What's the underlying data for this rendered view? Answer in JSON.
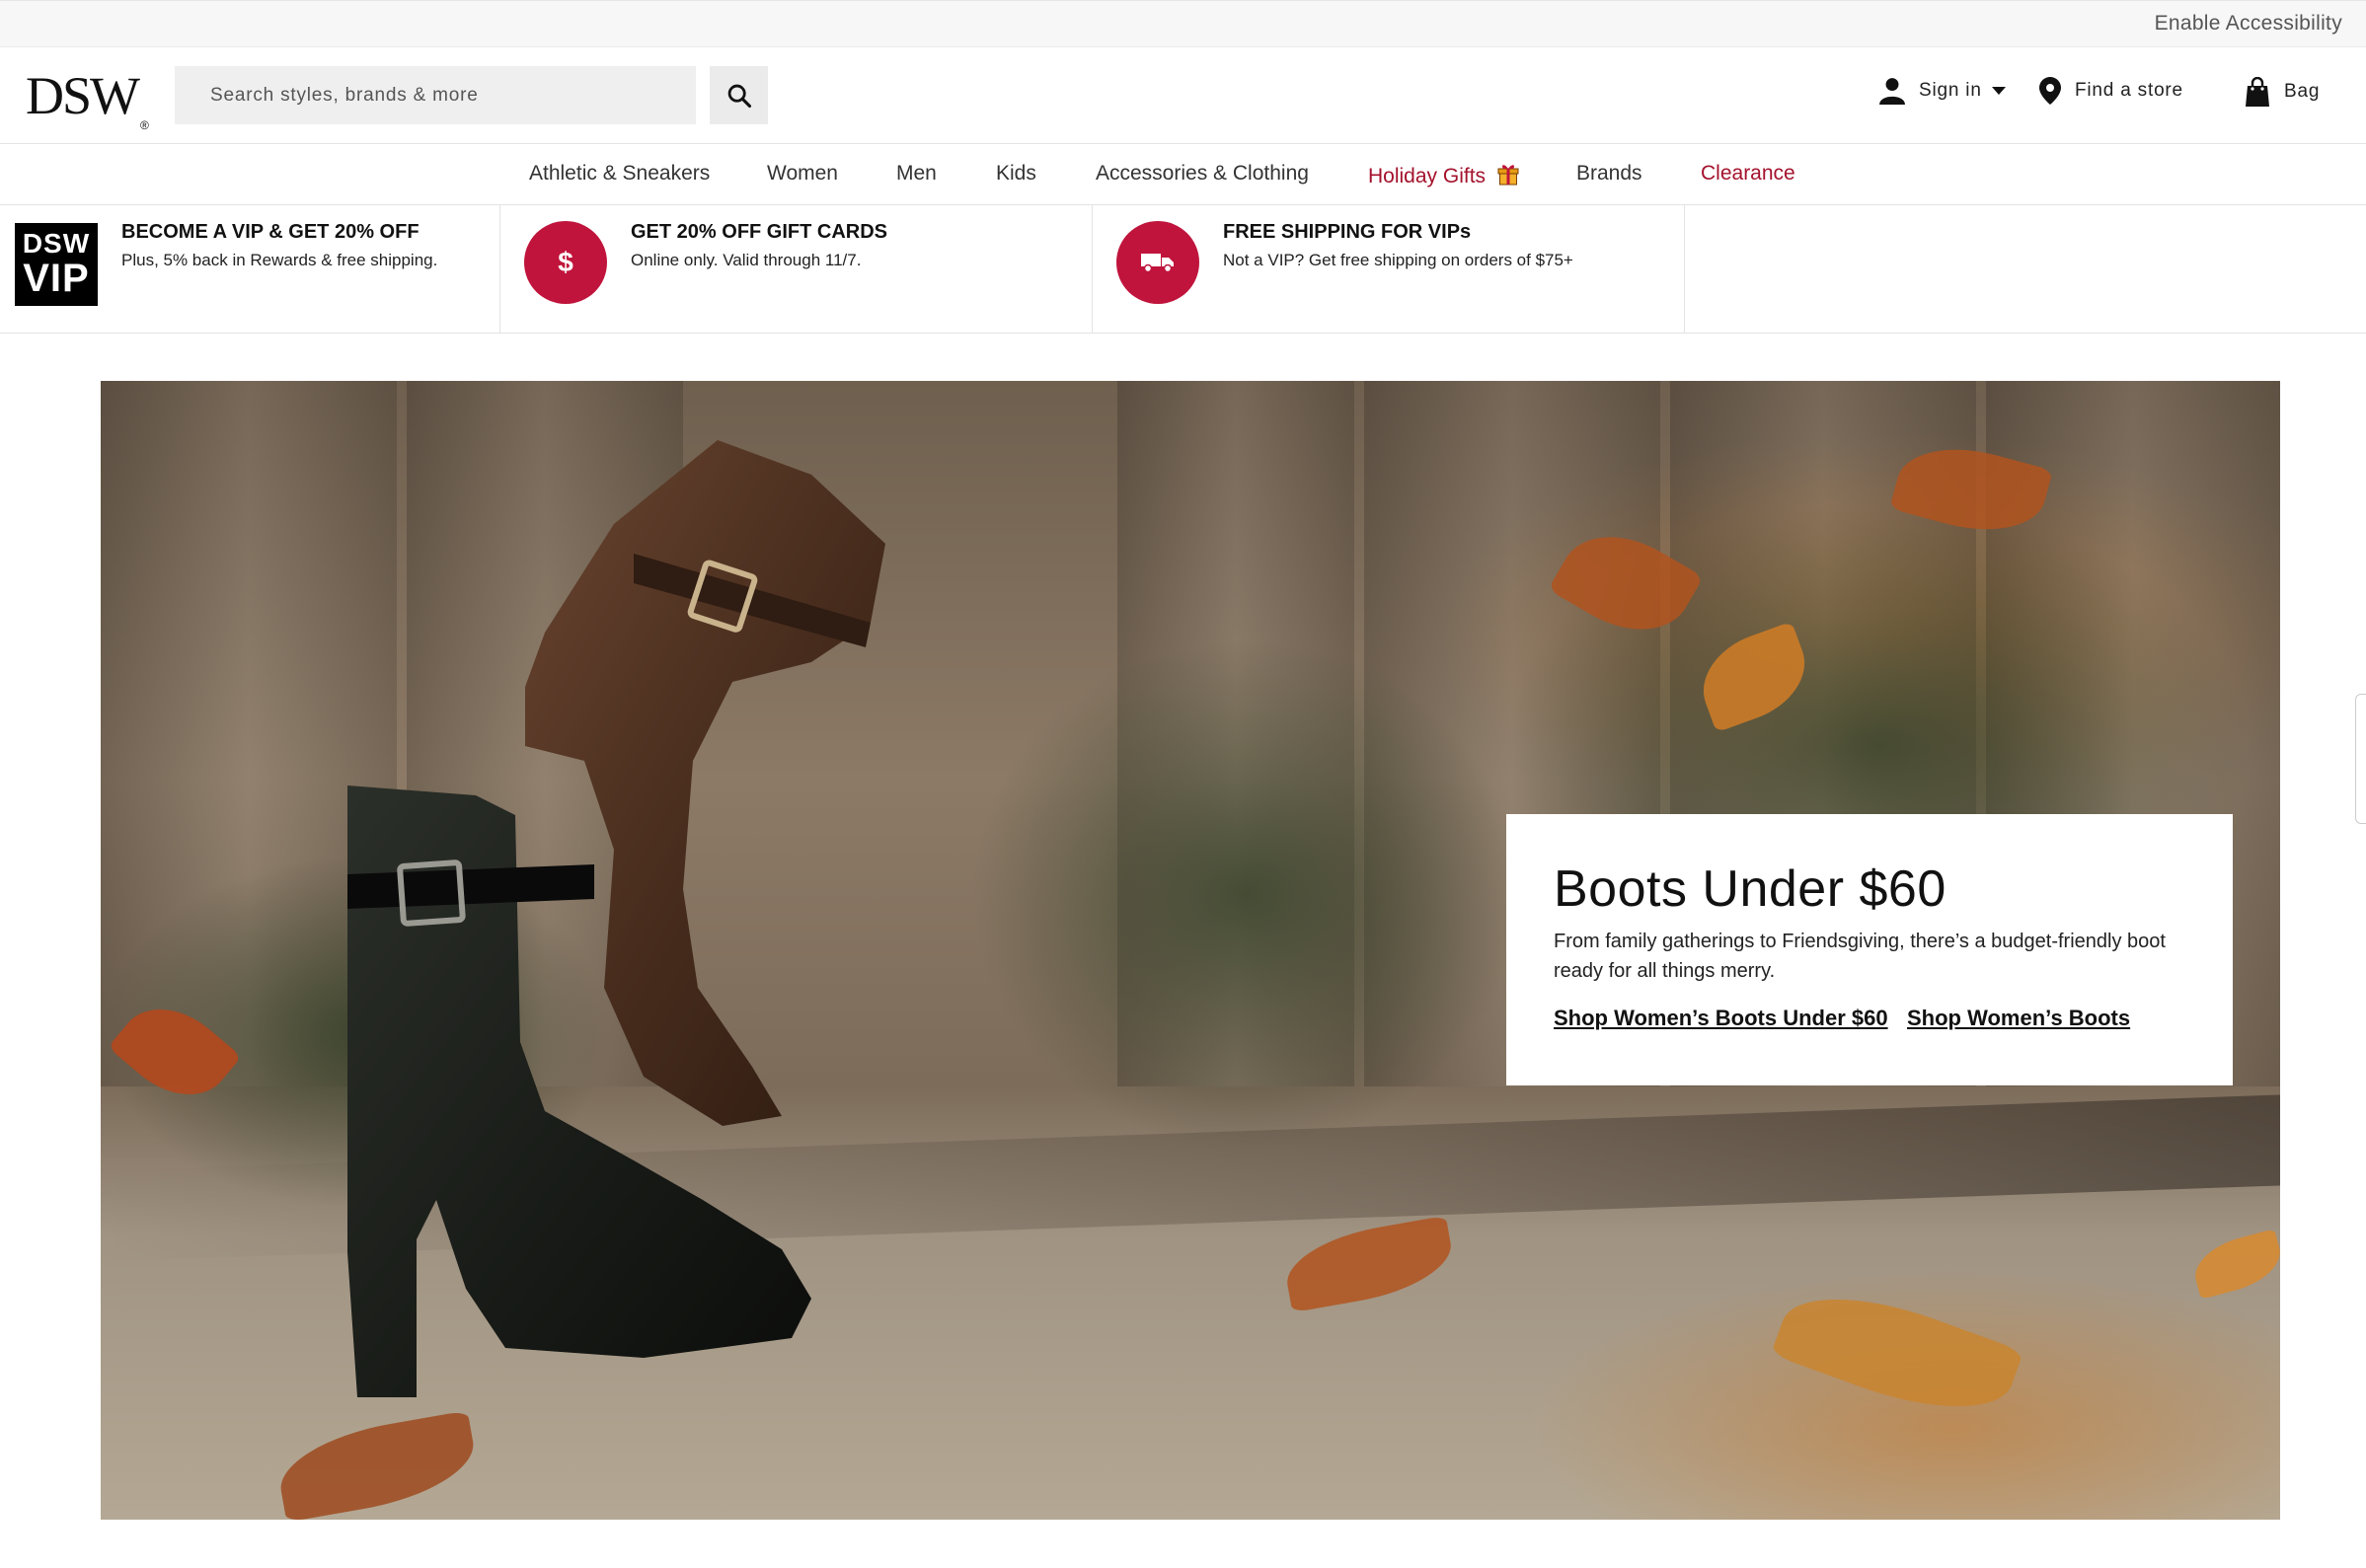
{
  "utility": {
    "accessibility_label": "Enable Accessibility"
  },
  "header": {
    "logo_text": "DSW",
    "logo_mark": "®",
    "search_placeholder": "Search styles, brands & more",
    "sign_in_label": "Sign in",
    "find_store_label": "Find a store",
    "bag_label": "Bag"
  },
  "nav": {
    "items": [
      {
        "label": "Athletic & Sneakers"
      },
      {
        "label": "Women"
      },
      {
        "label": "Men"
      },
      {
        "label": "Kids"
      },
      {
        "label": "Accessories & Clothing"
      },
      {
        "label": "Holiday Gifts"
      },
      {
        "label": "Brands"
      },
      {
        "label": "Clearance"
      }
    ],
    "highlight_color": "#a4122c"
  },
  "promos": [
    {
      "badge_line1": "DSW",
      "badge_line2": "VIP",
      "title": "BECOME A VIP & GET 20% OFF",
      "subtitle": "Plus, 5% back in Rewards & free shipping."
    },
    {
      "icon_symbol": "$",
      "title": "GET 20% OFF GIFT CARDS",
      "subtitle": "Online only. Valid through 11/7."
    },
    {
      "title": "FREE SHIPPING FOR VIPs",
      "subtitle": "Not a VIP? Get free shipping on orders of $75+"
    }
  ],
  "promo_accent_color": "#c0143c",
  "hero": {
    "heading": "Boots Under $60",
    "body": "From family gatherings to Friendsgiving, there’s a budget-friendly boot ready for all things merry.",
    "link1": "Shop Women’s Boots Under $60",
    "link2": "Shop Women’s Boots"
  }
}
